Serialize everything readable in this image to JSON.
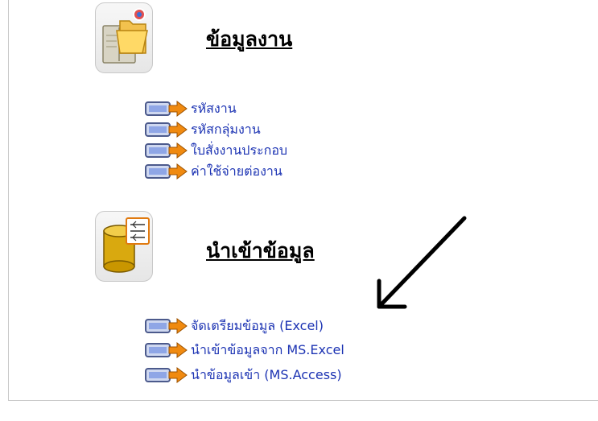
{
  "sections": [
    {
      "icon": "open-book-folder-icon",
      "title": "ข้อมูลงาน",
      "links": [
        {
          "label": "รหัสงาน",
          "icon": "arrow-link-icon"
        },
        {
          "label": "รหัสกลุ่มงาน",
          "icon": "arrow-link-icon"
        },
        {
          "label": "ใบสั่งงานประกอบ",
          "icon": "arrow-link-icon"
        },
        {
          "label": "ค่าใช้จ่ายต่องาน",
          "icon": "arrow-link-icon"
        }
      ]
    },
    {
      "icon": "database-import-icon",
      "title": "นำเข้าข้อมูล",
      "links": [
        {
          "label": "จัดเตรียมข้อมูล (Excel)",
          "icon": "arrow-link-icon"
        },
        {
          "label": "นำเข้าข้อมูลจาก MS.Excel",
          "icon": "arrow-link-icon"
        },
        {
          "label": "นำข้อมูลเข้า (MS.Access)",
          "icon": "arrow-link-icon"
        }
      ]
    }
  ],
  "colors": {
    "link": "#1c33b3",
    "title": "#000000",
    "icon_arrow": "#f08a10",
    "annotation_arrow": "#000000"
  },
  "annotation": {
    "icon": "black-pointer-arrow-icon"
  }
}
